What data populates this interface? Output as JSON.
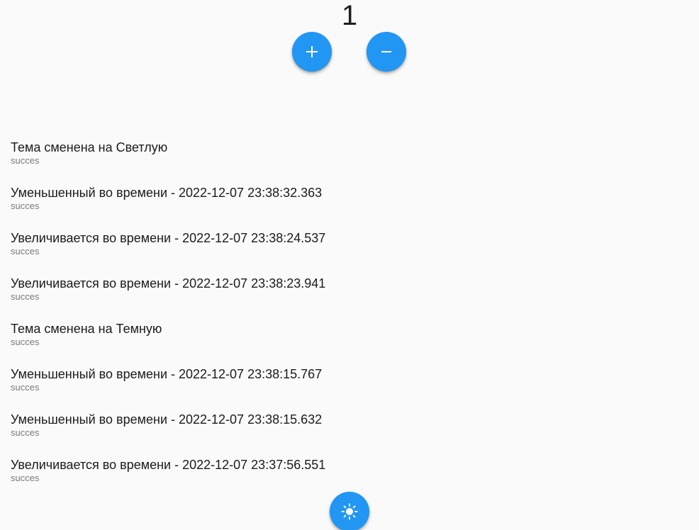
{
  "counter": {
    "value": "1"
  },
  "buttons": {
    "increment_icon": "plus-icon",
    "decrement_icon": "minus-icon",
    "theme_icon": "sun-icon",
    "accent_color": "#2196f3"
  },
  "log": {
    "items": [
      {
        "title": "Тема сменена на Светлую",
        "status": "succes"
      },
      {
        "title": "Уменьшенный во времени - 2022-12-07 23:38:32.363",
        "status": "succes"
      },
      {
        "title": "Увеличивается во времени - 2022-12-07 23:38:24.537",
        "status": "succes"
      },
      {
        "title": "Увеличивается во времени - 2022-12-07 23:38:23.941",
        "status": "succes"
      },
      {
        "title": "Тема сменена на Темную",
        "status": "succes"
      },
      {
        "title": "Уменьшенный во времени - 2022-12-07 23:38:15.767",
        "status": "succes"
      },
      {
        "title": "Уменьшенный во времени - 2022-12-07 23:38:15.632",
        "status": "succes"
      },
      {
        "title": "Увеличивается во времени - 2022-12-07 23:37:56.551",
        "status": "succes"
      }
    ]
  }
}
